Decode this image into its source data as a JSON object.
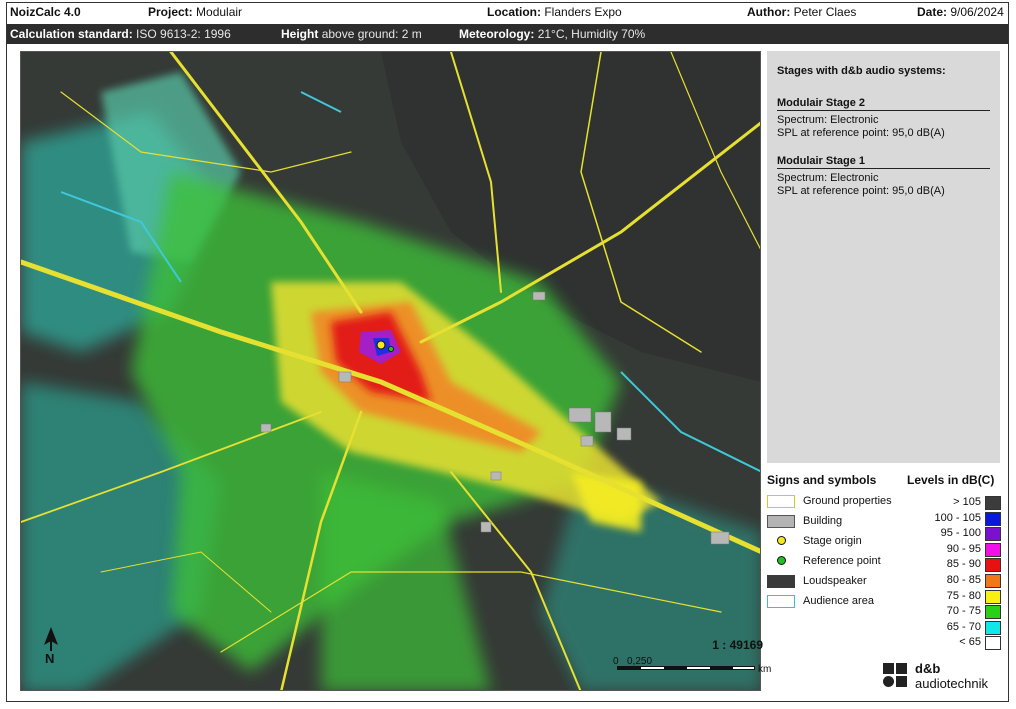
{
  "header": {
    "app": "NoizCalc 4.0",
    "project_label": "Project:",
    "project": "Modulair",
    "location_label": "Location:",
    "location": "Flanders Expo",
    "author_label": "Author:",
    "author": "Peter Claes",
    "date_label": "Date:",
    "date": "9/06/2024"
  },
  "infobar": {
    "standard_label": "Calculation standard:",
    "standard": "ISO 9613-2: 1996",
    "height_label": "Height",
    "height": "above ground: 2 m",
    "meteo_label": "Meteorology:",
    "meteo": "21°C, Humidity 70%"
  },
  "stages_panel": {
    "heading": "Stages with d&b audio systems:",
    "stages": [
      {
        "name": "Modulair Stage 2",
        "spectrum": "Spectrum:  Electronic",
        "spl": "SPL at reference point:  95,0 dB(A)"
      },
      {
        "name": "Modulair Stage 1",
        "spectrum": "Spectrum:  Electronic",
        "spl": "SPL at reference point:  95,0 dB(A)"
      }
    ]
  },
  "signs": {
    "title": "Signs and symbols",
    "items": [
      {
        "label": "Ground properties",
        "icon": "ground-properties-swatch"
      },
      {
        "label": "Building",
        "icon": "building-swatch"
      },
      {
        "label": "Stage origin",
        "icon": "stage-origin-dot"
      },
      {
        "label": "Reference point",
        "icon": "reference-point-dot"
      },
      {
        "label": "Loudspeaker",
        "icon": "loudspeaker-swatch"
      },
      {
        "label": "Audience area",
        "icon": "audience-area-swatch"
      }
    ]
  },
  "levels": {
    "title": "Levels in dB(C)",
    "items": [
      {
        "label": "> 105",
        "color": "#3c3c3c"
      },
      {
        "label": "100 -  105",
        "color": "#0a18d8"
      },
      {
        "label": "95 -  100",
        "color": "#7a10d0"
      },
      {
        "label": "90 -    95",
        "color": "#f010e8"
      },
      {
        "label": "85 -    90",
        "color": "#e81010"
      },
      {
        "label": "80 -    85",
        "color": "#f07818"
      },
      {
        "label": "75 -    80",
        "color": "#f8f010"
      },
      {
        "label": "70 -    75",
        "color": "#28d018"
      },
      {
        "label": "65 -    70",
        "color": "#10e8e8"
      },
      {
        "label": "<    65",
        "color": "#ffffff"
      }
    ]
  },
  "map": {
    "scale_ratio": "1 : 49169",
    "scale_ticks": [
      "0",
      "0,250"
    ],
    "scale_unit": "km",
    "north": "N",
    "colors": {
      "background": "#3a3f3a",
      "road": "#e6e030",
      "water": "#40c8d8"
    }
  },
  "logo": {
    "line1": "d&b",
    "line2": "audiotechnik"
  }
}
